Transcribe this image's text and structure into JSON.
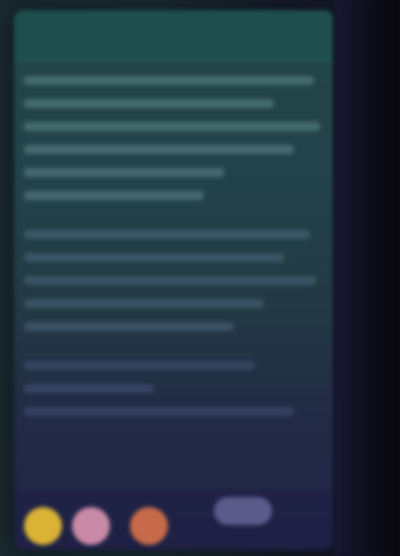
{
  "header": {
    "title": ""
  },
  "footer": {
    "avatars": [
      {
        "name": "avatar-yellow",
        "color": "#d9b236"
      },
      {
        "name": "avatar-pink",
        "color": "#c98aa6"
      },
      {
        "name": "avatar-orange",
        "color": "#c76a4a"
      }
    ],
    "button_color": "#5b5a8a"
  },
  "colors": {
    "panel_top": "#234646",
    "panel_bottom": "#202445",
    "header": "#1e4f4e"
  }
}
